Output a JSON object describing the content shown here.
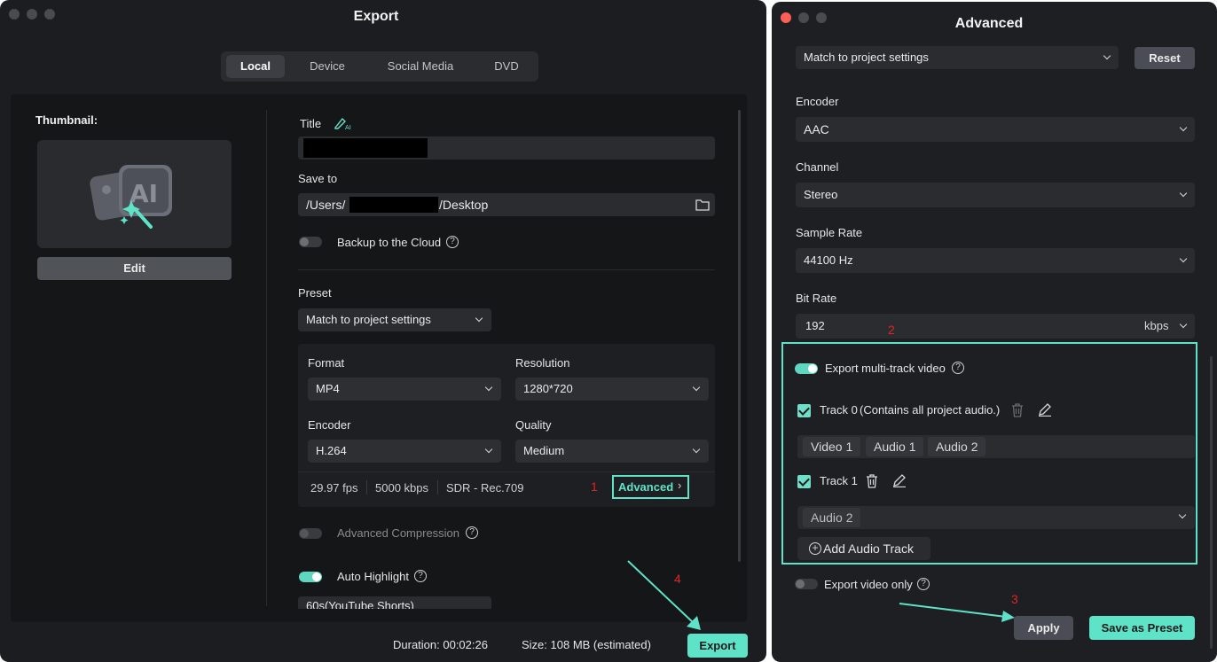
{
  "export_window": {
    "title": "Export",
    "tabs": [
      {
        "label": "Local",
        "active": true
      },
      {
        "label": "Device",
        "active": false
      },
      {
        "label": "Social Media",
        "active": false
      },
      {
        "label": "DVD",
        "active": false
      }
    ],
    "thumbnail": {
      "label": "Thumbnail:",
      "edit_label": "Edit",
      "icon": "ai-magic-image-icon"
    },
    "title_field": {
      "label": "Title",
      "value": ""
    },
    "save_to": {
      "label": "Save to",
      "prefix": "/Users/",
      "suffix": "/Desktop"
    },
    "backup": {
      "label": "Backup to the Cloud",
      "enabled": false
    },
    "preset": {
      "label": "Preset",
      "value": "Match to project settings"
    },
    "format": {
      "label": "Format",
      "value": "MP4"
    },
    "resolution": {
      "label": "Resolution",
      "value": "1280*720"
    },
    "encoder": {
      "label": "Encoder",
      "value": "H.264"
    },
    "quality": {
      "label": "Quality",
      "value": "Medium"
    },
    "stats": {
      "fps": "29.97 fps",
      "bitrate": "5000 kbps",
      "color": "SDR - Rec.709"
    },
    "advanced_button": "Advanced",
    "advanced_compression": {
      "label": "Advanced Compression",
      "enabled": false
    },
    "auto_highlight": {
      "label": "Auto Highlight",
      "enabled": true,
      "partial_value": "60s(YouTube Shorts)"
    },
    "duration": "Duration:  00:02:26",
    "size": "Size:  108 MB  (estimated)",
    "export_button": "Export"
  },
  "advanced_window": {
    "title": "Advanced",
    "preset_value": "Match to project settings",
    "reset_label": "Reset",
    "encoder": {
      "label": "Encoder",
      "value": "AAC"
    },
    "channel": {
      "label": "Channel",
      "value": "Stereo"
    },
    "sample_rate": {
      "label": "Sample Rate",
      "value": "44100 Hz"
    },
    "bit_rate": {
      "label": "Bit Rate",
      "value": "192",
      "unit": "kbps"
    },
    "multitrack": {
      "label": "Export multi-track video",
      "enabled": true
    },
    "track0": {
      "name": "Track 0",
      "note": "(Contains all project audio.)",
      "checked": true,
      "chips": [
        "Video 1",
        "Audio 1",
        "Audio 2"
      ]
    },
    "track1": {
      "name": "Track 1",
      "checked": true,
      "chips": [
        "Audio 2"
      ]
    },
    "add_audio_track": "Add Audio Track",
    "export_video_only": {
      "label": "Export video only",
      "enabled": false
    },
    "apply_label": "Apply",
    "save_preset_label": "Save as Preset"
  },
  "annotations": {
    "n1": "1",
    "n2": "2",
    "n3": "3",
    "n4": "4",
    "color": "#e02424",
    "highlight_color": "#5fe3c8"
  }
}
